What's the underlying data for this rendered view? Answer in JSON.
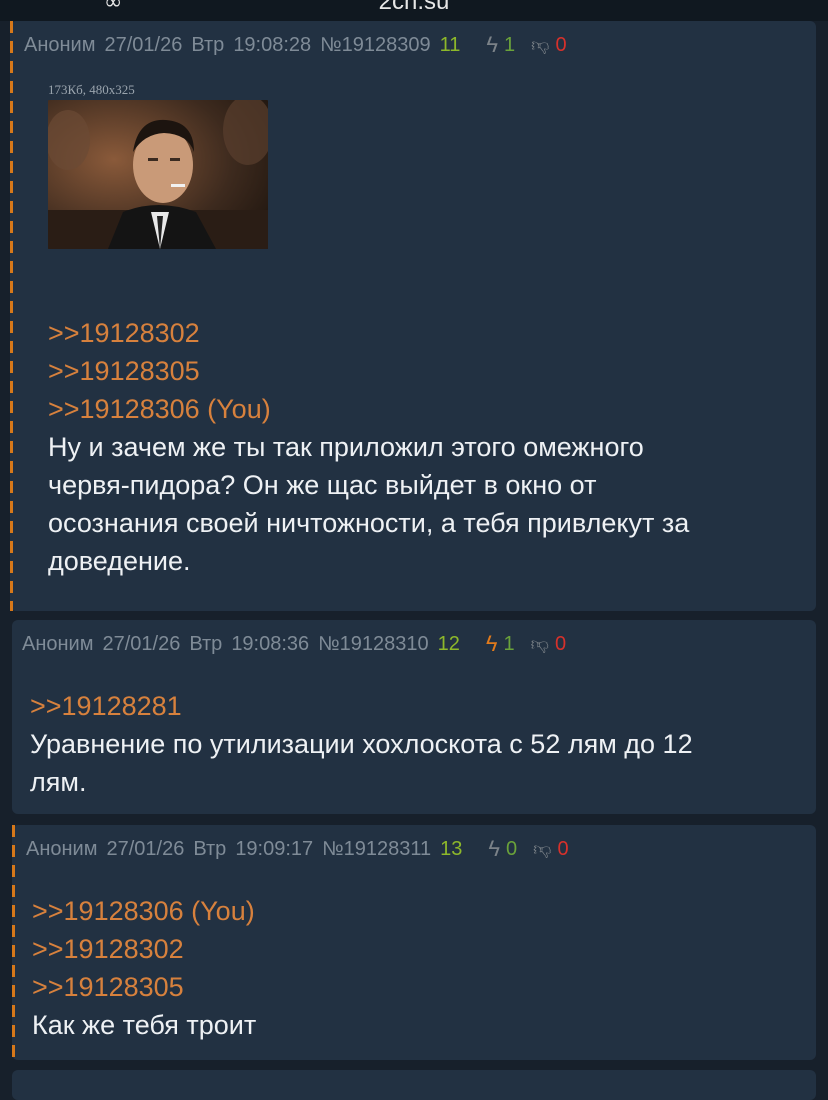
{
  "topbar": {
    "site": "2ch.su",
    "menu_icon": "binoculars-icon"
  },
  "posts": [
    {
      "author": "Аноним",
      "date": "27/01/26",
      "weekday": "Втр",
      "time": "19:08:28",
      "number": "№19128309",
      "index": "11",
      "likes": "1",
      "dislikes": "0",
      "file_info": "173Кб, 480x325",
      "replies": [
        ">>19128302",
        ">>19128305",
        ">>19128306 (You)"
      ],
      "text": [
        "Ну и зачем же ты так приложил этого омежного",
        "червя-пидора? Он же щас выйдет в окно от",
        "осознания своей ничтожности, а тебя привлекут за",
        "доведение."
      ]
    },
    {
      "author": "Аноним",
      "date": "27/01/26",
      "weekday": "Втр",
      "time": "19:08:36",
      "number": "№19128310",
      "index": "12",
      "likes": "1",
      "dislikes": "0",
      "replies": [
        ">>19128281"
      ],
      "text": [
        "Уравнение по утилизации хохлоскота с 52 лям до 12",
        "лям."
      ]
    },
    {
      "author": "Аноним",
      "date": "27/01/26",
      "weekday": "Втр",
      "time": "19:09:17",
      "number": "№19128311",
      "index": "13",
      "likes": "0",
      "dislikes": "0",
      "replies": [
        ">>19128306 (You)",
        ">>19128302",
        ">>19128305"
      ],
      "text": [
        "Как же тебя троит"
      ]
    }
  ],
  "colors": {
    "background": "#17202b",
    "post": "#223142",
    "reply": "#d7813d",
    "accent_orange": "#d6781a",
    "green": "#8db82a",
    "red": "#d7312b"
  }
}
